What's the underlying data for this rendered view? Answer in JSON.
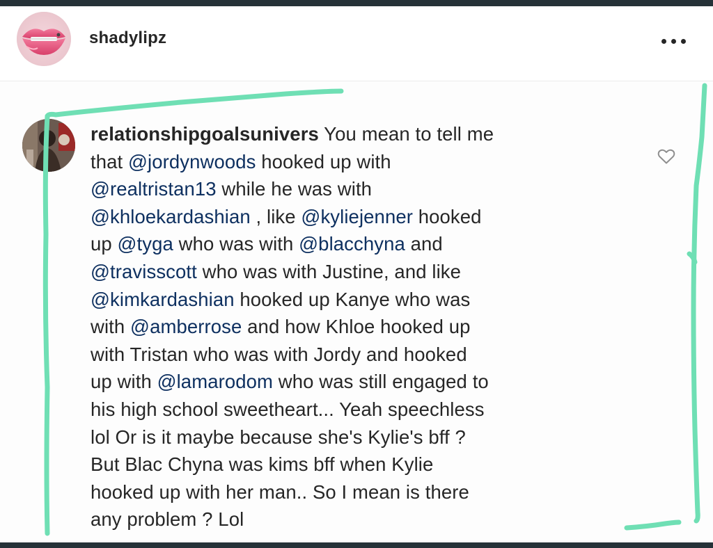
{
  "post": {
    "username": "shadylipz",
    "avatar_icon": "lips-avatar-icon",
    "more_icon": "more-options-icon"
  },
  "comment": {
    "username": "relationshipgoalsunivers",
    "like_icon": "heart-icon",
    "highlight_color": "#6fdfb4",
    "mention_color": "#0e3060",
    "lines": [
      [
        {
          "t": " You mean to tell me",
          "k": "text"
        }
      ],
      [
        {
          "t": "that ",
          "k": "text"
        },
        {
          "t": "@jordynwoods",
          "k": "mention"
        },
        {
          "t": " hooked up with",
          "k": "text"
        }
      ],
      [
        {
          "t": "@realtristan13",
          "k": "mention"
        },
        {
          "t": " while he was with",
          "k": "text"
        }
      ],
      [
        {
          "t": "@khloekardashian",
          "k": "mention"
        },
        {
          "t": " , like ",
          "k": "text"
        },
        {
          "t": "@kyliejenner",
          "k": "mention"
        },
        {
          "t": " hooked",
          "k": "text"
        }
      ],
      [
        {
          "t": "up ",
          "k": "text"
        },
        {
          "t": "@tyga",
          "k": "mention"
        },
        {
          "t": " who was with ",
          "k": "text"
        },
        {
          "t": "@blacchyna",
          "k": "mention"
        },
        {
          "t": " and",
          "k": "text"
        }
      ],
      [
        {
          "t": "@travisscott",
          "k": "mention"
        },
        {
          "t": " who was with Justine, and like",
          "k": "text"
        }
      ],
      [
        {
          "t": "@kimkardashian",
          "k": "mention"
        },
        {
          "t": " hooked up Kanye who was",
          "k": "text"
        }
      ],
      [
        {
          "t": "with ",
          "k": "text"
        },
        {
          "t": "@amberrose",
          "k": "mention"
        },
        {
          "t": " and how Khloe hooked up",
          "k": "text"
        }
      ],
      [
        {
          "t": "with Tristan who was with Jordy and hooked",
          "k": "text"
        }
      ],
      [
        {
          "t": "up with ",
          "k": "text"
        },
        {
          "t": "@lamarodom",
          "k": "mention"
        },
        {
          "t": " who was still engaged to",
          "k": "text"
        }
      ],
      [
        {
          "t": "his high school sweetheart... Yeah speechless",
          "k": "text"
        }
      ],
      [
        {
          "t": "lol Or is it maybe because she's Kylie's bff ?",
          "k": "text"
        }
      ],
      [
        {
          "t": "But Blac Chyna was kims bff when Kylie",
          "k": "text"
        }
      ],
      [
        {
          "t": "hooked up with her man.. So I mean is there",
          "k": "text"
        }
      ],
      [
        {
          "t": "any problem ? Lol",
          "k": "text"
        }
      ]
    ]
  }
}
